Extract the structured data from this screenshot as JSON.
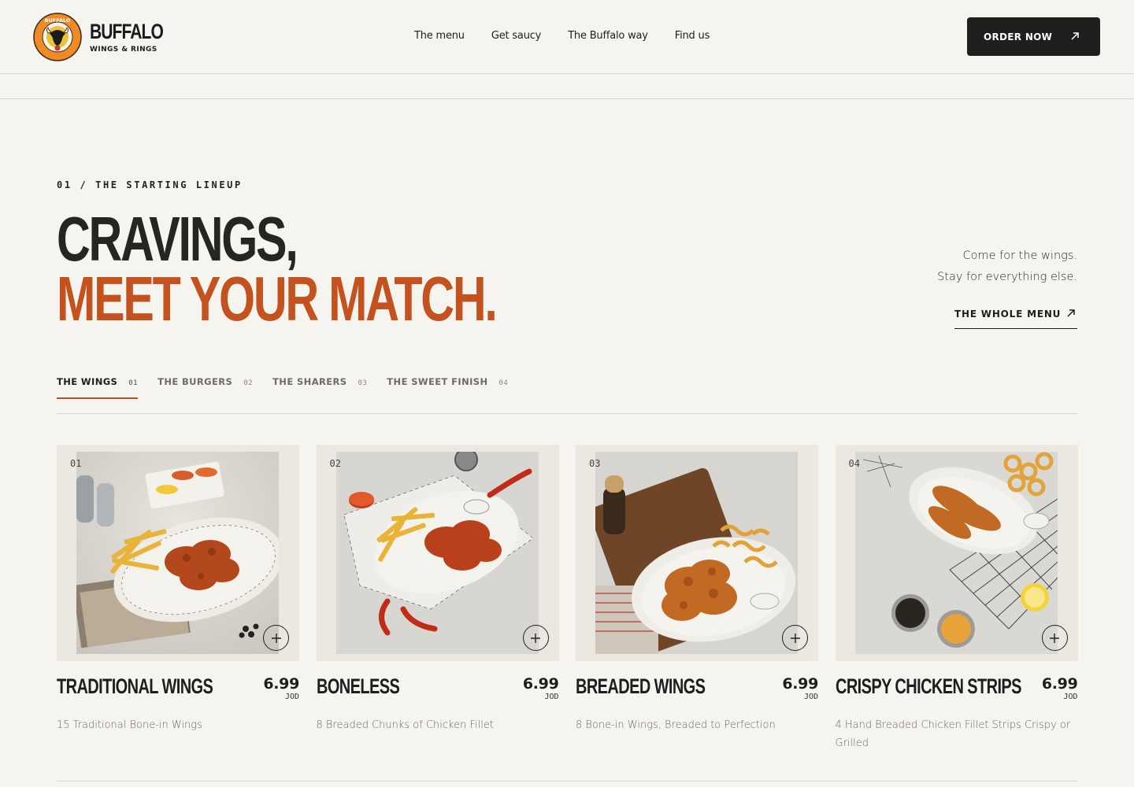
{
  "brand": {
    "name": "BUFFALO",
    "sub": "WINGS & RINGS",
    "badge_text": "BUFFALO WINGS & RINGS",
    "accent": "#c4521e",
    "dark": "#1f1f1d"
  },
  "nav": [
    {
      "label": "The menu"
    },
    {
      "label": "Get saucy"
    },
    {
      "label": "The Buffalo way"
    },
    {
      "label": "Find us"
    }
  ],
  "order_button": {
    "label": "ORDER NOW",
    "icon": "arrow-up-right-icon"
  },
  "hero": {
    "eyebrow": "01 / THE STARTING LINEUP",
    "line1": "CRAVINGS,",
    "line2": "MEET YOUR MATCH.",
    "tagline1": "Come for the wings.",
    "tagline2": "Stay for everything else.",
    "cta": "THE WHOLE MENU"
  },
  "tabs": [
    {
      "label": "THE WINGS",
      "num": "01",
      "active": true
    },
    {
      "label": "THE BURGERS",
      "num": "02",
      "active": false
    },
    {
      "label": "THE SHARERS",
      "num": "03",
      "active": false
    },
    {
      "label": "THE SWEET FINISH",
      "num": "04",
      "active": false
    }
  ],
  "items": [
    {
      "num": "01",
      "title": "TRADITIONAL WINGS",
      "price": "6.99",
      "currency": "JOD",
      "desc": "15 Traditional Bone-in Wings"
    },
    {
      "num": "02",
      "title": "BONELESS",
      "price": "6.99",
      "currency": "JOD",
      "desc": "8 Breaded Chunks of Chicken Fillet"
    },
    {
      "num": "03",
      "title": "BREADED WINGS",
      "price": "6.99",
      "currency": "JOD",
      "desc": "8 Bone-in Wings, Breaded to Perfection"
    },
    {
      "num": "04",
      "title": "CRISPY CHICKEN STRIPS",
      "price": "6.99",
      "currency": "JOD",
      "desc": "4 Hand Breaded Chicken Fillet Strips Crispy or Grilled"
    }
  ]
}
